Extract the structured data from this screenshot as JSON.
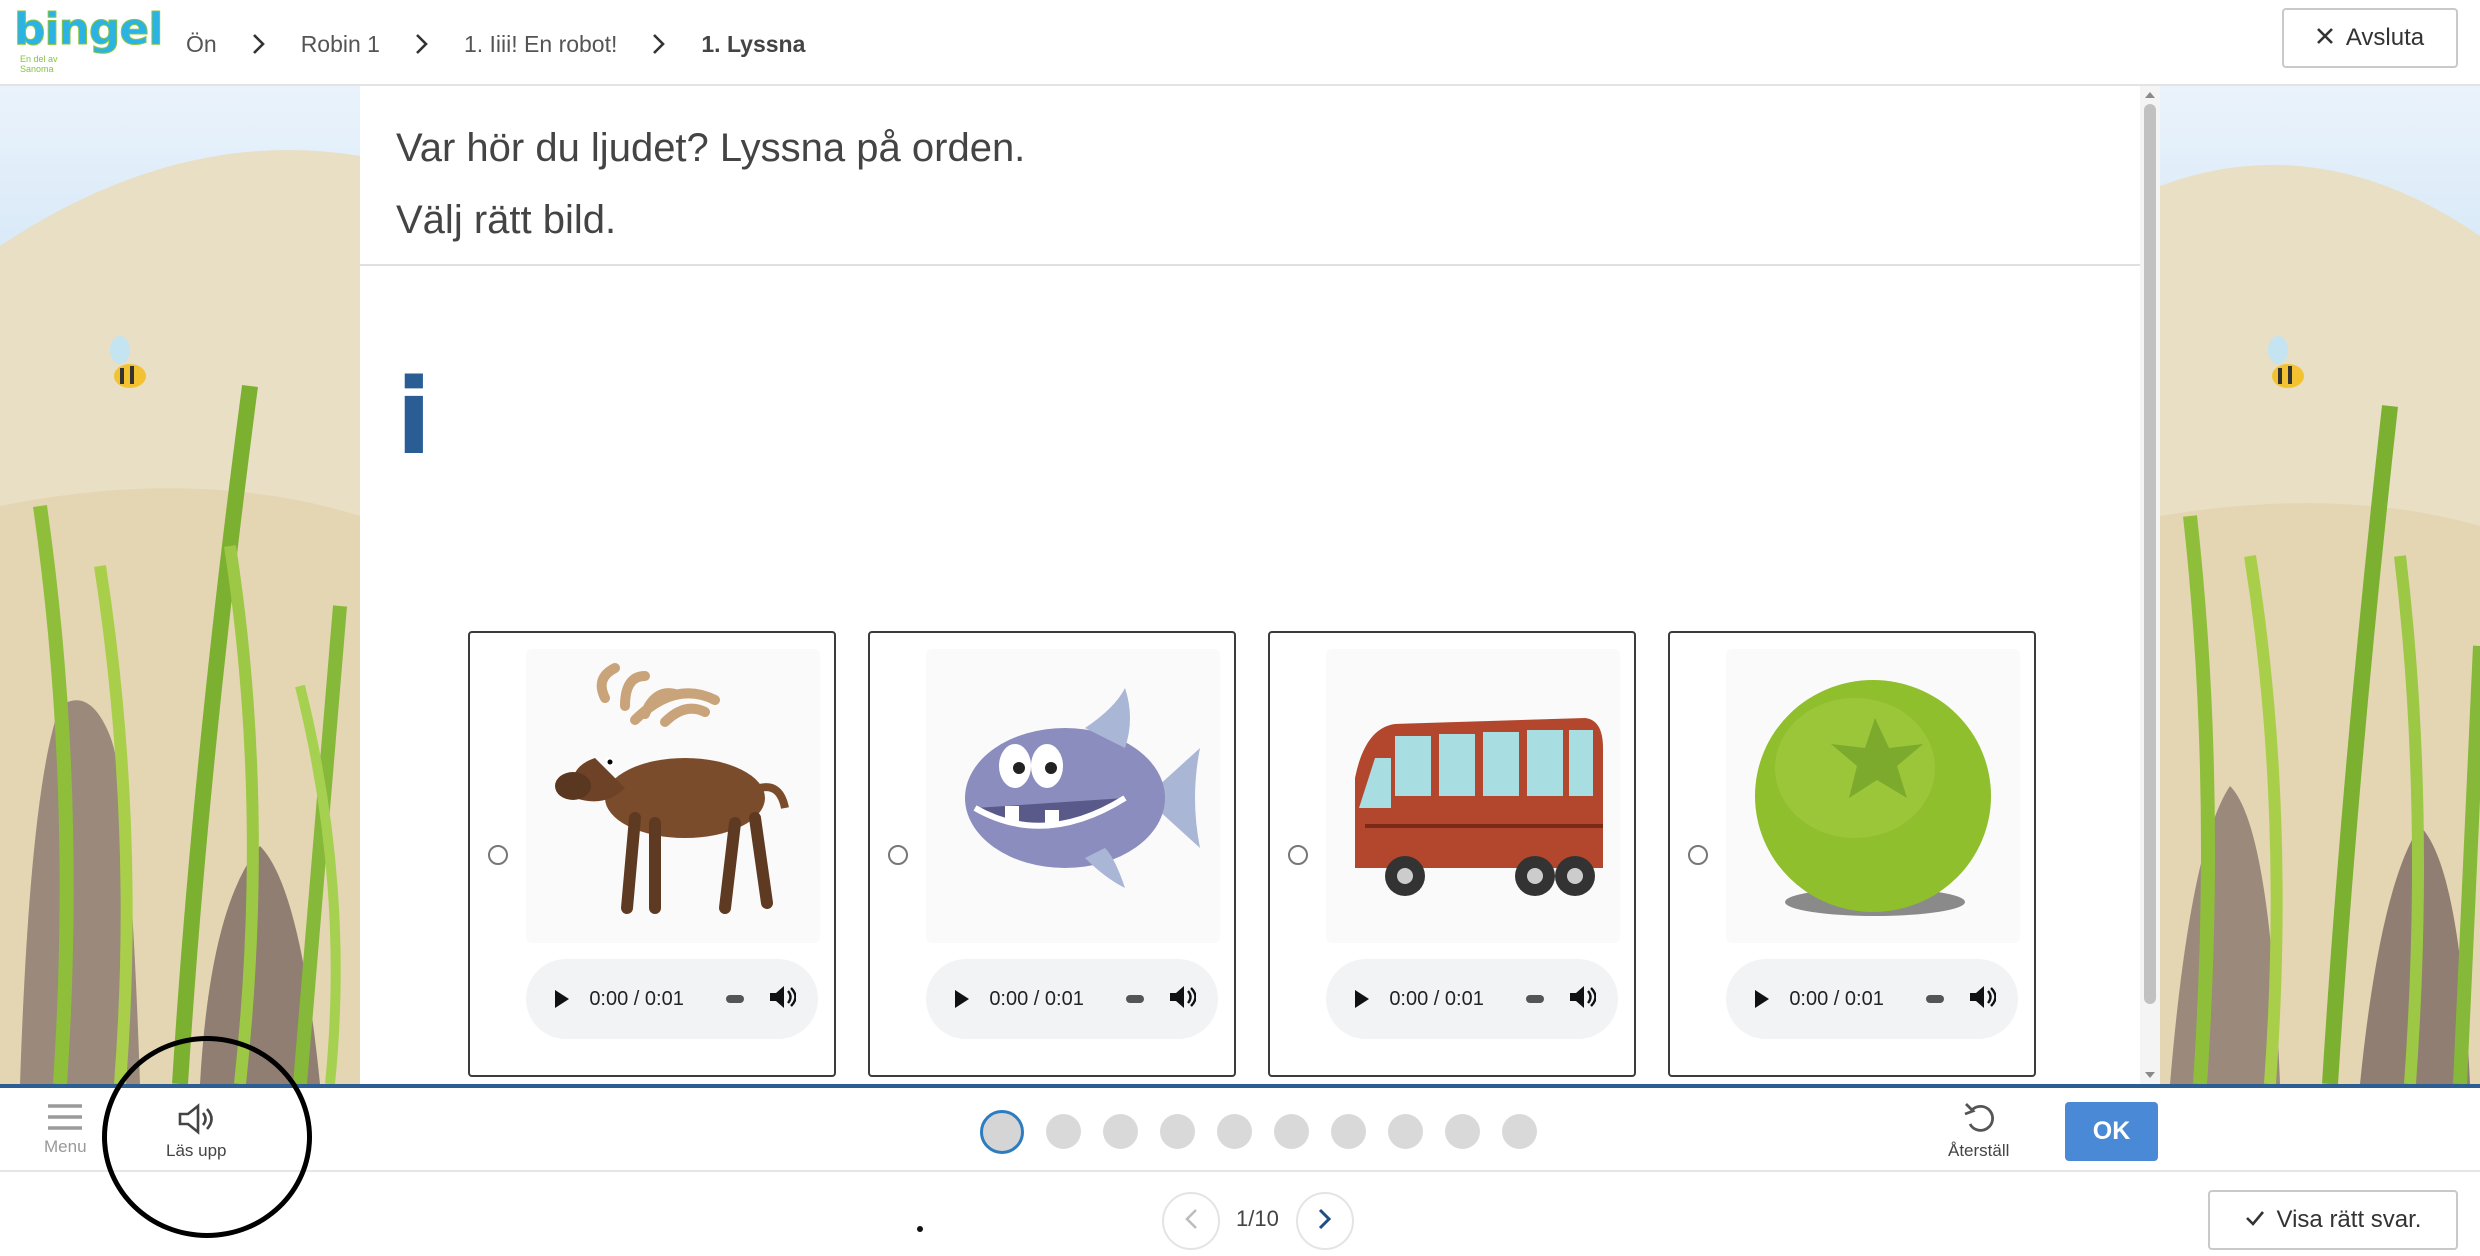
{
  "logo": {
    "word": "bingel",
    "tagline": "En del av Sanoma"
  },
  "breadcrumb": [
    {
      "label": "Ön",
      "active": false
    },
    {
      "label": "Robin 1",
      "active": false
    },
    {
      "label": "1. Iiii! En robot!",
      "active": false
    },
    {
      "label": "1. Lyssna",
      "active": true
    }
  ],
  "header": {
    "close_label": "Avsluta"
  },
  "question": {
    "line1": "Var hör du ljudet? Lyssna på orden.",
    "line2": "Välj rätt bild.",
    "letter": "i"
  },
  "options": [
    {
      "picture": "moose",
      "audio_time": "0:00 / 0:01"
    },
    {
      "picture": "fish",
      "audio_time": "0:00 / 0:01"
    },
    {
      "picture": "bus",
      "audio_time": "0:00 / 0:01"
    },
    {
      "picture": "green-ball",
      "audio_time": "0:00 / 0:01"
    }
  ],
  "toolbar": {
    "menu_label": "Menu",
    "read_aloud_label": "Läs upp",
    "reset_label": "Återställ",
    "ok_label": "OK",
    "progress_dots": 10,
    "current_step": 1
  },
  "pager": {
    "count": "1/10"
  },
  "footer": {
    "show_answer_label": "Visa rätt svar."
  },
  "colors": {
    "accent_blue": "#2d5e93",
    "ok_button": "#4a89d6",
    "letter_color": "#2b5d95"
  }
}
